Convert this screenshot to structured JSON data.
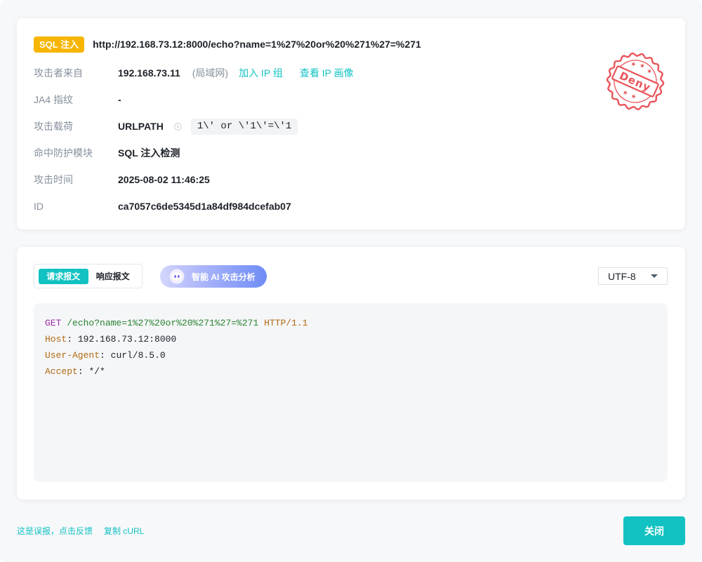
{
  "colors": {
    "accent": "#12c2c2",
    "badge": "#f7b500",
    "stamp": "#e9545a",
    "label": "#86909c",
    "text": "#1d2129",
    "syntax_method": "#a12fa8",
    "syntax_path": "#27822f",
    "syntax_key": "#b06a12"
  },
  "summary": {
    "attack_type_badge": "SQL 注入",
    "url": "http://192.168.73.12:8000/echo?name=1%27%20or%20%271%27=%271",
    "attacker": {
      "label": "攻击者来自",
      "ip": "192.168.73.11",
      "network": "(局域网)",
      "add_to_ip_group": "加入 IP 组",
      "view_ip_profile": "查看 IP 画像"
    },
    "ja4": {
      "label": "JA4 指纹",
      "value": "-"
    },
    "payload": {
      "label": "攻击载荷",
      "location": "URLPATH",
      "icon": "arrow-circle-icon",
      "value": "1\\' or \\'1\\'=\\'1"
    },
    "module": {
      "label": "命中防护模块",
      "value": "SQL 注入检测"
    },
    "time": {
      "label": "攻击时间",
      "value": "2025-08-02 11:46:25"
    },
    "event_id": {
      "label": "ID",
      "value": "ca7057c6de5345d1a84df984dcefab07"
    }
  },
  "stamp": {
    "text": "Deny"
  },
  "message_panel": {
    "tabs": [
      {
        "label": "请求报文",
        "active": true
      },
      {
        "label": "响应报文",
        "active": false
      }
    ],
    "ai_button": {
      "label": "智能 AI 攻击分析",
      "icon": "ai-assistant-icon"
    },
    "encoding": {
      "selected": "UTF-8",
      "icon": "caret-down-icon"
    },
    "request": {
      "method": "GET",
      "path": "/echo?name=1%27%20or%20%271%27=%271",
      "version": "HTTP/1.1",
      "header_separator": ":",
      "headers": [
        {
          "name": "Host",
          "value": "192.168.73.12:8000"
        },
        {
          "name": "User-Agent",
          "value": "curl/8.5.0"
        },
        {
          "name": "Accept",
          "value": "*/*"
        }
      ]
    }
  },
  "footer": {
    "report_false_positive": "这是误报，点击反馈",
    "copy_curl": "复制 cURL",
    "close": "关闭"
  }
}
